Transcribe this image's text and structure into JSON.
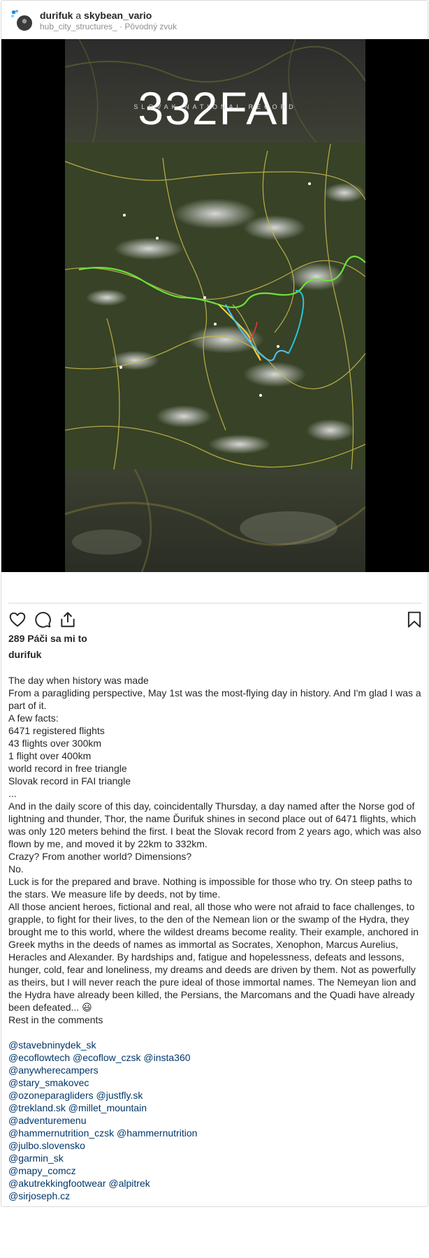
{
  "post": {
    "author": "durifuk",
    "connector": "a",
    "collaborator": "skybean_vario",
    "subtitle": "hub_city_structures_ · Pôvodný zvuk"
  },
  "media": {
    "title_overlay": "332FAI",
    "subtitle_overlay": "SLOVAK NATIONAL RECORD"
  },
  "actions": {
    "like_icon": "heart-icon",
    "comment_icon": "comment-icon",
    "share_icon": "share-icon",
    "save_icon": "bookmark-icon"
  },
  "likes_text": "289 Páči sa mi to",
  "caption_author": "durifuk",
  "caption_lines": [
    "The day when history was made",
    "From a paragliding perspective, May 1st was the most-flying day in history. And I'm glad I was a part of it.",
    "A few facts:",
    "6471 registered flights",
    "43 flights over 300km",
    "1 flight over 400km",
    "world record in free triangle",
    "Slovak record in FAI triangle",
    "...",
    "And in the daily score of this day, coincidentally Thursday, a day named after the Norse god of lightning and thunder, Thor, the name Ďurifuk shines in second place out of 6471 flights, which was only 120 meters behind the first. I beat the Slovak record from 2 years ago, which was also flown by me, and moved it by 22km to 332km.",
    "Crazy? From another world? Dimensions?",
    "No.",
    "Luck is for the prepared and brave. Nothing is impossible for those who try. On steep paths to the stars. We measure life by deeds, not by time.",
    "All those ancient heroes, fictional and real, all those who were not afraid to face challenges, to grapple, to fight for their lives, to the den of the Nemean lion or the swamp of the Hydra, they brought me to this world, where the wildest dreams become reality. Their example, anchored in Greek myths in the deeds of names as immortal as Socrates, Xenophon, Marcus Aurelius, Heracles and Alexander. By hardships and, fatigue and hopelessness, defeats and lessons, hunger, cold, fear and loneliness, my dreams and deeds are driven by them. Not as powerfully as theirs, but I will never reach the pure ideal of those immortal names. The Nemeyan lion and the Hydra have already been killed, the Persians, the Marcomans and the Quadi have already been defeated... 😃",
    "Rest in the comments"
  ],
  "mentions": [
    "@stavebninydek_sk",
    "@ecoflowtech @ecoflow_czsk @insta360",
    "@anywherecampers",
    "@stary_smakovec",
    "@ozoneparagliders @justfly.sk",
    "@trekland.sk @millet_mountain",
    "@adventuremenu",
    "@hammernutrition_czsk @hammernutrition",
    "@julbo.slovensko",
    "@garmin_sk",
    "@mapy_comcz",
    "@akutrekkingfootwear @alpitrek",
    "@sirjoseph.cz"
  ],
  "colors": {
    "link": "#00376b",
    "muted": "#8e8e8e",
    "border": "#dbdbdb"
  }
}
